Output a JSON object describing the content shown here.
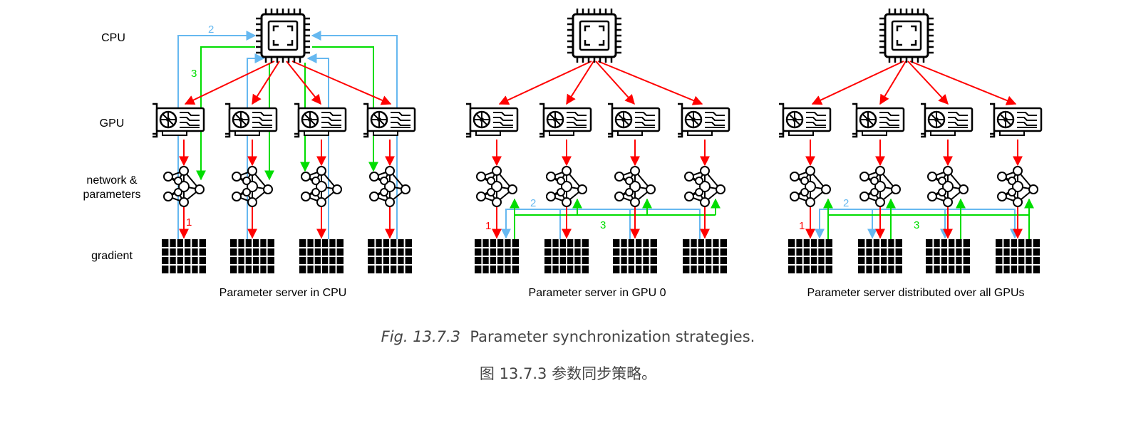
{
  "row_labels": {
    "cpu": "CPU",
    "gpu": "GPU",
    "network_line1": "network &",
    "network_line2": "parameters",
    "gradient": "gradient"
  },
  "panels": [
    {
      "caption": "Parameter server in CPU",
      "step_labels": [
        "1",
        "2",
        "3"
      ]
    },
    {
      "caption": "Parameter server in GPU 0",
      "step_labels": [
        "1",
        "2",
        "3"
      ]
    },
    {
      "caption": "Parameter server distributed over all GPUs",
      "step_labels": [
        "1",
        "2",
        "3"
      ]
    }
  ],
  "caption": {
    "figure_number": "Fig. 13.7.3",
    "text": "Parameter synchronization strategies.",
    "chinese": "图 13.7.3 参数同步策略。"
  },
  "colors": {
    "step1": "#ff0000",
    "step2": "#66b8f0",
    "step3": "#00dd00",
    "icon": "#000000"
  },
  "icons": {
    "cpu": "cpu-chip-icon",
    "gpu": "graphics-card-icon",
    "network": "neural-network-icon",
    "gradient": "gradient-grid-icon"
  }
}
